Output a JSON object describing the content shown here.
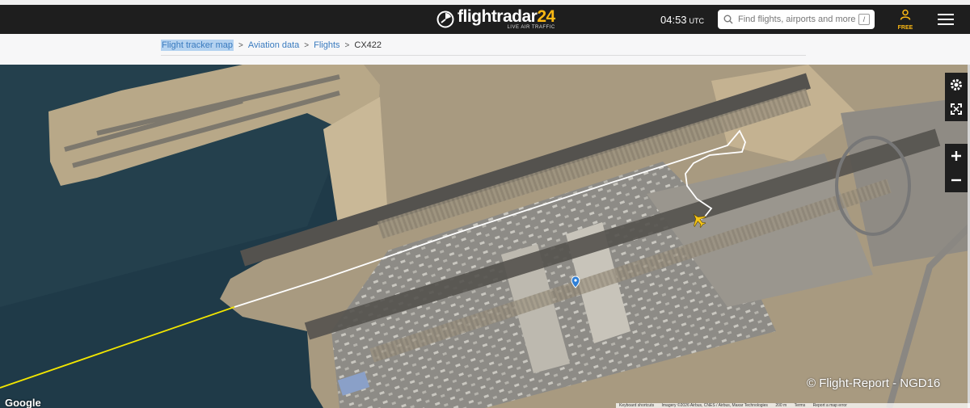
{
  "header": {
    "logo": {
      "word": "flightradar",
      "number": "24",
      "tagline": "LIVE AIR TRAFFIC"
    },
    "clock": {
      "time": "04:53",
      "timezone": "UTC"
    },
    "search": {
      "placeholder": "Find flights, airports and more",
      "shortcut": "/"
    },
    "user": {
      "label": "FREE"
    }
  },
  "breadcrumb": {
    "items": [
      {
        "label": "Flight tracker map"
      },
      {
        "label": "Aviation data"
      },
      {
        "label": "Flights"
      }
    ],
    "separator": ">",
    "current": "CX422"
  },
  "map": {
    "google_label": "Google",
    "watermark": "© Flight-Report - NGD16",
    "attribution": {
      "shortcuts": "Keyboard shortcuts",
      "imagery": "Imagery ©2026 Airbus, CNES / Airbus, Maxar Technologies",
      "scale": "200 m",
      "terms": "Terms",
      "report": "Report a map error"
    },
    "controls": [
      "settings-icon",
      "fullscreen-icon",
      "zoom-in-icon",
      "zoom-out-icon"
    ],
    "colors": {
      "track_white": "#ffffff",
      "track_yellow": "#f2e600",
      "aircraft": "#f5c518",
      "water": "#1f3a48",
      "land": "#b8a68a"
    }
  }
}
